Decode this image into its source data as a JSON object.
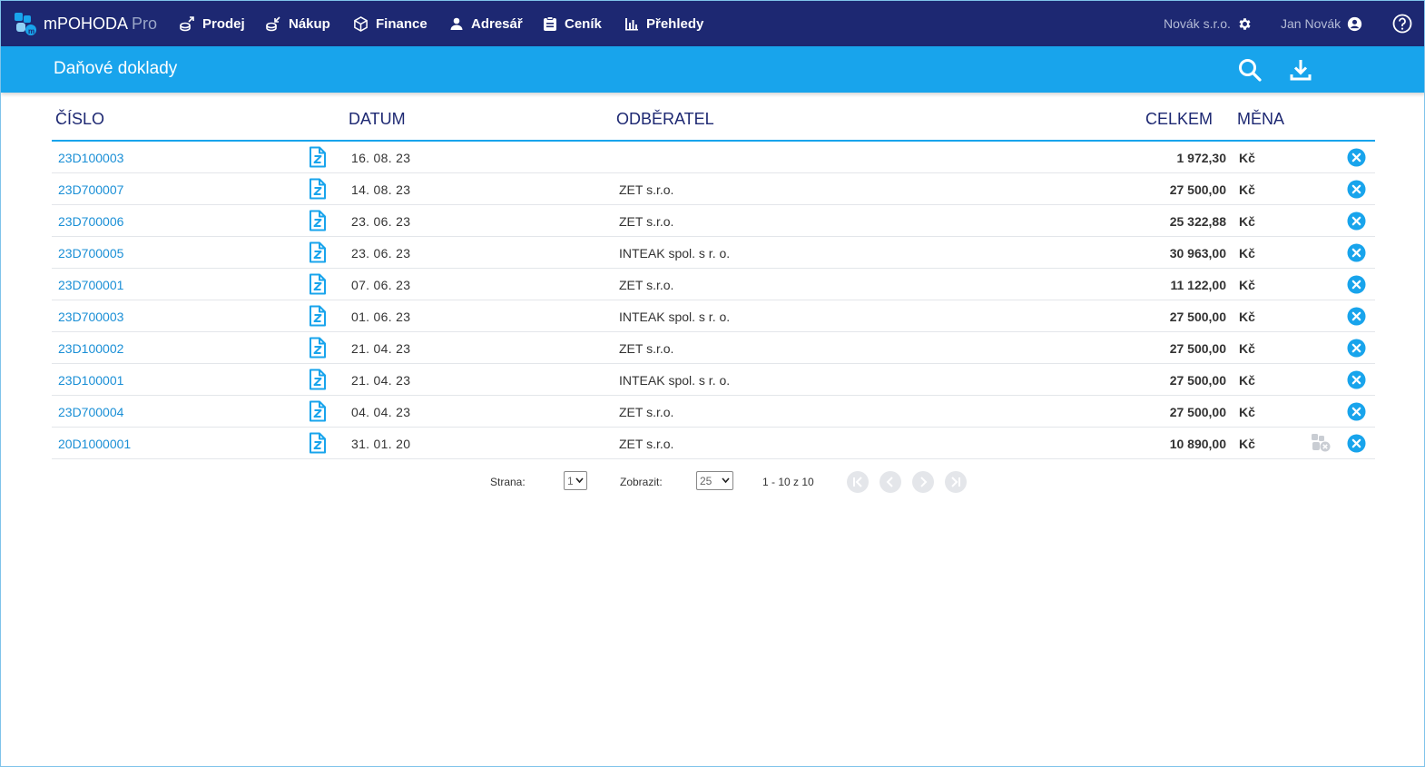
{
  "app": {
    "brand": "mPOHODA",
    "edition": "Pro"
  },
  "nav": [
    {
      "label": "Prodej",
      "icon": "sales-icon"
    },
    {
      "label": "Nákup",
      "icon": "purchase-icon"
    },
    {
      "label": "Finance",
      "icon": "finance-icon"
    },
    {
      "label": "Adresář",
      "icon": "person-icon"
    },
    {
      "label": "Ceník",
      "icon": "pricelist-icon"
    },
    {
      "label": "Přehledy",
      "icon": "bar-chart-icon"
    }
  ],
  "company": "Novák s.r.o.",
  "user": "Jan Novák",
  "page": {
    "title": "Daňové doklady"
  },
  "table": {
    "headers": {
      "number": "ČÍSLO",
      "date": "DATUM",
      "partner": "ODBĚRATEL",
      "total": "CELKEM",
      "currency": "MĚNA"
    },
    "rows": [
      {
        "number": "23D100003",
        "date": "16. 08. 23",
        "partner": "",
        "total": "1 972,30",
        "currency": "Kč"
      },
      {
        "number": "23D700007",
        "date": "14. 08. 23",
        "partner": "ZET s.r.o.",
        "total": "27 500,00",
        "currency": "Kč"
      },
      {
        "number": "23D700006",
        "date": "23. 06. 23",
        "partner": "ZET s.r.o.",
        "total": "25 322,88",
        "currency": "Kč"
      },
      {
        "number": "23D700005",
        "date": "23. 06. 23",
        "partner": "INTEAK spol. s r. o.",
        "total": "30 963,00",
        "currency": "Kč"
      },
      {
        "number": "23D700001",
        "date": "07. 06. 23",
        "partner": "ZET s.r.o.",
        "total": "11 122,00",
        "currency": "Kč"
      },
      {
        "number": "23D700003",
        "date": "01. 06. 23",
        "partner": "INTEAK spol. s r. o.",
        "total": "27 500,00",
        "currency": "Kč"
      },
      {
        "number": "23D100002",
        "date": "21. 04. 23",
        "partner": "ZET s.r.o.",
        "total": "27 500,00",
        "currency": "Kč"
      },
      {
        "number": "23D100001",
        "date": "21. 04. 23",
        "partner": "INTEAK spol. s r. o.",
        "total": "27 500,00",
        "currency": "Kč"
      },
      {
        "number": "23D700004",
        "date": "04. 04. 23",
        "partner": "ZET s.r.o.",
        "total": "27 500,00",
        "currency": "Kč"
      },
      {
        "number": "20D1000001",
        "date": "31. 01. 20",
        "partner": "ZET s.r.o.",
        "total": "10 890,00",
        "currency": "Kč"
      }
    ]
  },
  "pager": {
    "page_label": "Strana:",
    "page_value": "1",
    "show_label": "Zobrazit:",
    "show_value": "25",
    "range_text": "1 - 10 z 10"
  },
  "colors": {
    "nav_bg": "#1d2872",
    "accent": "#18a4ec",
    "link": "#1a8fd6"
  }
}
